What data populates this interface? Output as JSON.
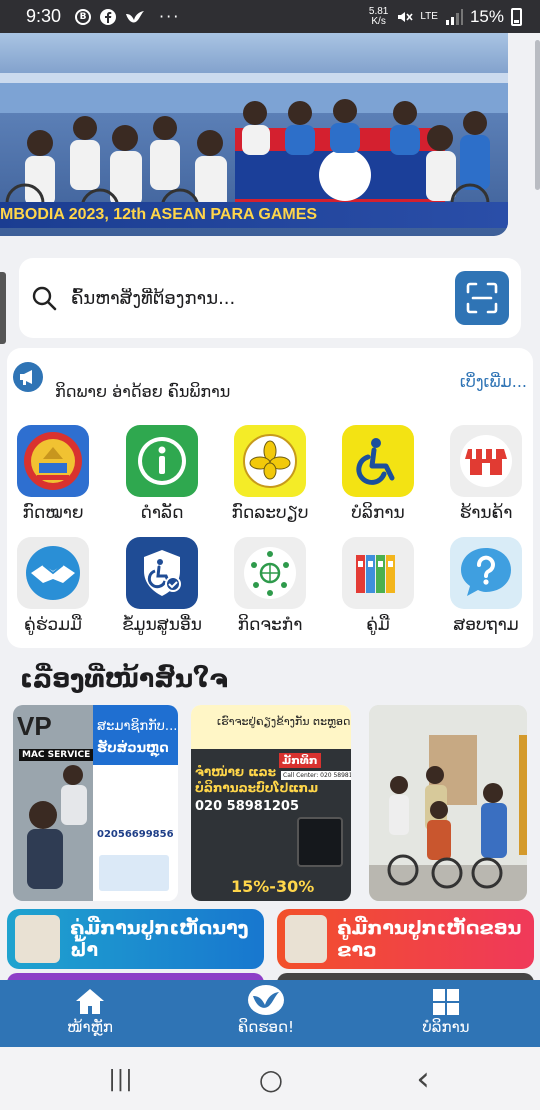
{
  "status_bar": {
    "time": "9:30",
    "left_icons": [
      "b-circle-icon",
      "facebook-icon",
      "bird-app-icon"
    ],
    "more": "···",
    "net_speed": "5.81",
    "net_speed_unit": "K/s",
    "network": "LTE",
    "battery": "15%"
  },
  "banner": {
    "caption": "MBODIA 2023, 12th ASEAN PARA GAMES",
    "colors": {
      "sky": "#a9c4e3",
      "caption_bg": "#1b3d91",
      "caption_text": "#ffd64a"
    }
  },
  "search": {
    "placeholder": "ຄົ້ນຫາສິ່ງທີ່ຕ້ອງການ..."
  },
  "news": {
    "title": "ກິດພາຍ ອ່າດ້ອຍ ຄົນພິການ",
    "see_more": "ເບິ່ງເພີ່ມ..."
  },
  "services": [
    {
      "label": "ກົດໝາຍ",
      "icon": "lao-emblem-icon"
    },
    {
      "label": "ດໍາລັດ",
      "icon": "info-icon"
    },
    {
      "label": "ກົດລະບຽບ",
      "icon": "flower-seal-icon"
    },
    {
      "label": "ບໍລິການ",
      "icon": "wheelchair-icon"
    },
    {
      "label": "ຮ້ານຄ້າ",
      "icon": "store-icon"
    },
    {
      "label": "ຄູ່ຮ່ວມມື",
      "icon": "handshake-icon"
    },
    {
      "label": "ຂໍ້ມູນສູນອື່ນ",
      "icon": "shield-wheelchair-icon"
    },
    {
      "label": "ກິດຈະກໍາ",
      "icon": "community-icon"
    },
    {
      "label": "ຄູ່ມື",
      "icon": "binders-icon"
    },
    {
      "label": "ສອບຖາມ",
      "icon": "question-bubble-icon"
    }
  ],
  "featured": {
    "title": "ເລື່ອງທີ່ໜ້າສົນໃຈ",
    "cards": [
      {
        "brand": "VP",
        "shop_name": "MAC SERVICE",
        "headline": "ສະມາຊິກກັບ...",
        "subhead": "ຮັບສ່ວນຫຼຸດ",
        "phone": "02056699856"
      },
      {
        "headline": "ເຮົາຈະຢູ່ຄຽງຂ້າງກັນ ຕະຫຼອດ",
        "line1": "ຈຳໜ່າຍ ແລະ",
        "line2": "ບໍລິການລະບົບໂປແກມ",
        "phone": "020 58981205",
        "call_center": "Call Center: 020 58981205",
        "brand": "ມັກທິກ",
        "discount": "15%-30%"
      },
      {
        "description": "photo"
      }
    ]
  },
  "guides": [
    {
      "label": "ຄູ່ມືການປູກເຫັດນາງຟ້າ",
      "color": "#1fa3cf"
    },
    {
      "label": "ຄູ່ມືການປູກເຫັດຂອນຂາວ",
      "color": "#f2502a"
    }
  ],
  "bottom_nav": {
    "items": [
      {
        "label": "ໜ້າຫຼັກ",
        "icon": "home-icon"
      },
      {
        "label": "ຄິດຮອດ!",
        "icon": "bird-logo-icon"
      },
      {
        "label": "ບໍລິການ",
        "icon": "grid-icon"
      }
    ],
    "color": "#2f74b5"
  },
  "system_nav": {
    "recents": "|||",
    "home": "○",
    "back": "‹"
  }
}
